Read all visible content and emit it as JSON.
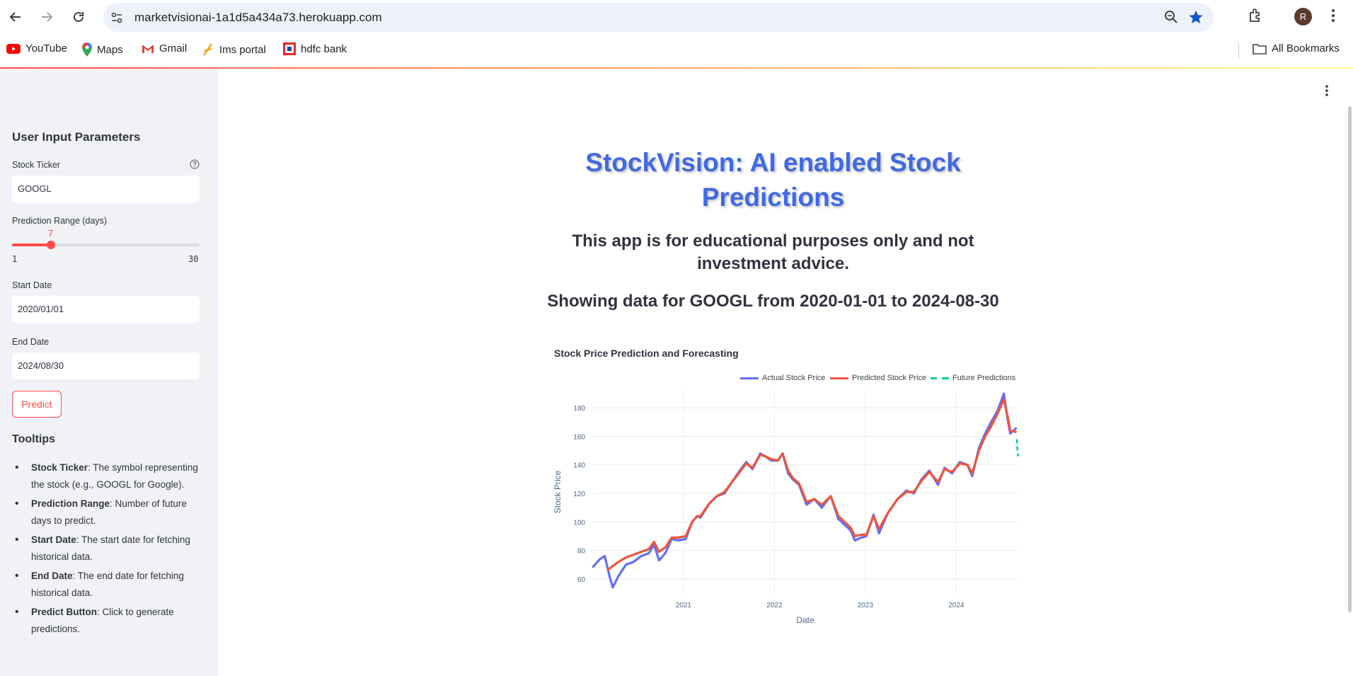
{
  "browser": {
    "url": "marketvisionai-1a1d5a434a73.herokuapp.com",
    "profile_initial": "R",
    "bookmarks": [
      {
        "label": "YouTube",
        "icon": "youtube-icon"
      },
      {
        "label": "Maps",
        "icon": "maps-icon"
      },
      {
        "label": "Gmail",
        "icon": "gmail-icon"
      },
      {
        "label": "Ims portal",
        "icon": "ims-icon"
      },
      {
        "label": "hdfc bank",
        "icon": "hdfc-icon"
      }
    ],
    "all_bookmarks_label": "All Bookmarks"
  },
  "sidebar": {
    "heading": "User Input Parameters",
    "ticker": {
      "label": "Stock Ticker",
      "value": "GOOGL"
    },
    "range": {
      "label": "Prediction Range (days)",
      "value": 7,
      "min": 1,
      "max": 30
    },
    "start_date": {
      "label": "Start Date",
      "value": "2020/01/01"
    },
    "end_date": {
      "label": "End Date",
      "value": "2024/08/30"
    },
    "predict_label": "Predict",
    "tooltips_heading": "Tooltips",
    "tooltips": [
      {
        "term": "Stock Ticker",
        "text": ": The symbol representing the stock (e.g., GOOGL for Google)."
      },
      {
        "term": "Prediction Range",
        "text": ": Number of future days to predict."
      },
      {
        "term": "Start Date",
        "text": ": The start date for fetching historical data."
      },
      {
        "term": "End Date",
        "text": ": The end date for fetching historical data."
      },
      {
        "term": "Predict Button",
        "text": ": Click to generate predictions."
      }
    ]
  },
  "main": {
    "title": "StockVision: AI enabled Stock Predictions",
    "disclaimer": "This app is for educational purposes only and not investment advice.",
    "showing": "Showing data for GOOGL from 2020-01-01 to 2024-08-30"
  },
  "chart_data": {
    "type": "line",
    "title": "Stock Price Prediction and Forecasting",
    "xlabel": "Date",
    "ylabel": "Stock Price",
    "x_ticks": [
      "2021",
      "2022",
      "2023",
      "2024"
    ],
    "y_ticks": [
      60,
      80,
      100,
      120,
      140,
      160,
      180
    ],
    "xlim": [
      "2020-01-01",
      "2024-09-06"
    ],
    "ylim": [
      50,
      192
    ],
    "grid": true,
    "legend_position": "top-right",
    "colors": {
      "actual": "#636efa",
      "predicted": "#ef553b",
      "future": "#00cc96"
    },
    "series": [
      {
        "name": "Actual Stock Price",
        "x": [
          "2020-01-02",
          "2020-02-01",
          "2020-02-20",
          "2020-03-10",
          "2020-03-23",
          "2020-04-15",
          "2020-05-15",
          "2020-06-15",
          "2020-07-15",
          "2020-08-15",
          "2020-09-05",
          "2020-09-25",
          "2020-10-20",
          "2020-11-15",
          "2020-12-10",
          "2021-01-10",
          "2021-02-05",
          "2021-02-25",
          "2021-03-10",
          "2021-04-15",
          "2021-05-15",
          "2021-06-15",
          "2021-07-15",
          "2021-08-15",
          "2021-09-10",
          "2021-10-05",
          "2021-11-05",
          "2021-11-25",
          "2021-12-20",
          "2022-01-15",
          "2022-02-03",
          "2022-02-25",
          "2022-03-15",
          "2022-04-10",
          "2022-05-10",
          "2022-06-10",
          "2022-07-10",
          "2022-08-15",
          "2022-09-15",
          "2022-10-10",
          "2022-11-03",
          "2022-11-20",
          "2022-12-15",
          "2023-01-05",
          "2023-02-03",
          "2023-02-25",
          "2023-04-01",
          "2023-05-10",
          "2023-06-15",
          "2023-07-15",
          "2023-08-15",
          "2023-09-15",
          "2023-10-20",
          "2023-11-15",
          "2023-12-15",
          "2024-01-15",
          "2024-02-15",
          "2024-03-05",
          "2024-04-01",
          "2024-04-26",
          "2024-05-20",
          "2024-06-15",
          "2024-07-10",
          "2024-07-25",
          "2024-08-05",
          "2024-08-30"
        ],
        "y": [
          68,
          74,
          76,
          62,
          54,
          62,
          70,
          72,
          76,
          78,
          84,
          73,
          78,
          88,
          87,
          88,
          100,
          104,
          103,
          113,
          118,
          120,
          128,
          136,
          142,
          137,
          148,
          146,
          143,
          143,
          148,
          134,
          130,
          126,
          112,
          116,
          110,
          118,
          102,
          98,
          94,
          87,
          89,
          90,
          105,
          92,
          106,
          116,
          122,
          120,
          130,
          136,
          126,
          138,
          134,
          142,
          140,
          132,
          152,
          162,
          170,
          178,
          190,
          172,
          162,
          166
        ]
      },
      {
        "name": "Predicted Stock Price",
        "x": [
          "2020-03-01",
          "2020-03-23",
          "2020-04-15",
          "2020-05-15",
          "2020-06-15",
          "2020-07-15",
          "2020-08-15",
          "2020-09-05",
          "2020-09-25",
          "2020-10-20",
          "2020-11-15",
          "2020-12-10",
          "2021-01-10",
          "2021-02-05",
          "2021-02-25",
          "2021-03-10",
          "2021-04-15",
          "2021-05-15",
          "2021-06-15",
          "2021-07-15",
          "2021-08-15",
          "2021-09-10",
          "2021-10-05",
          "2021-11-05",
          "2021-11-25",
          "2021-12-20",
          "2022-01-15",
          "2022-02-03",
          "2022-02-25",
          "2022-03-15",
          "2022-04-10",
          "2022-05-10",
          "2022-06-10",
          "2022-07-10",
          "2022-08-15",
          "2022-09-15",
          "2022-10-10",
          "2022-11-03",
          "2022-11-20",
          "2022-12-15",
          "2023-01-05",
          "2023-02-03",
          "2023-02-25",
          "2023-04-01",
          "2023-05-10",
          "2023-06-15",
          "2023-07-15",
          "2023-08-15",
          "2023-09-15",
          "2023-10-20",
          "2023-11-15",
          "2023-12-15",
          "2024-01-15",
          "2024-02-15",
          "2024-03-05",
          "2024-04-01",
          "2024-04-26",
          "2024-05-20",
          "2024-06-15",
          "2024-07-10",
          "2024-07-25",
          "2024-08-05",
          "2024-08-30"
        ],
        "y": [
          66,
          69,
          72,
          75,
          77,
          79,
          81,
          86,
          79,
          82,
          89,
          89,
          90,
          100,
          104,
          104,
          113,
          118,
          121,
          128,
          135,
          141,
          138,
          147,
          146,
          144,
          143,
          148,
          136,
          131,
          127,
          114,
          116,
          112,
          118,
          104,
          100,
          96,
          90,
          91,
          91,
          104,
          95,
          106,
          116,
          121,
          121,
          129,
          135,
          128,
          137,
          135,
          141,
          140,
          134,
          150,
          160,
          167,
          176,
          186,
          174,
          164,
          163
        ]
      },
      {
        "name": "Future Predictions",
        "x": [
          "2024-08-31",
          "2024-09-01",
          "2024-09-02",
          "2024-09-03",
          "2024-09-04",
          "2024-09-05",
          "2024-09-06"
        ],
        "y": [
          158,
          155,
          152,
          150,
          148,
          147,
          146
        ]
      }
    ]
  }
}
